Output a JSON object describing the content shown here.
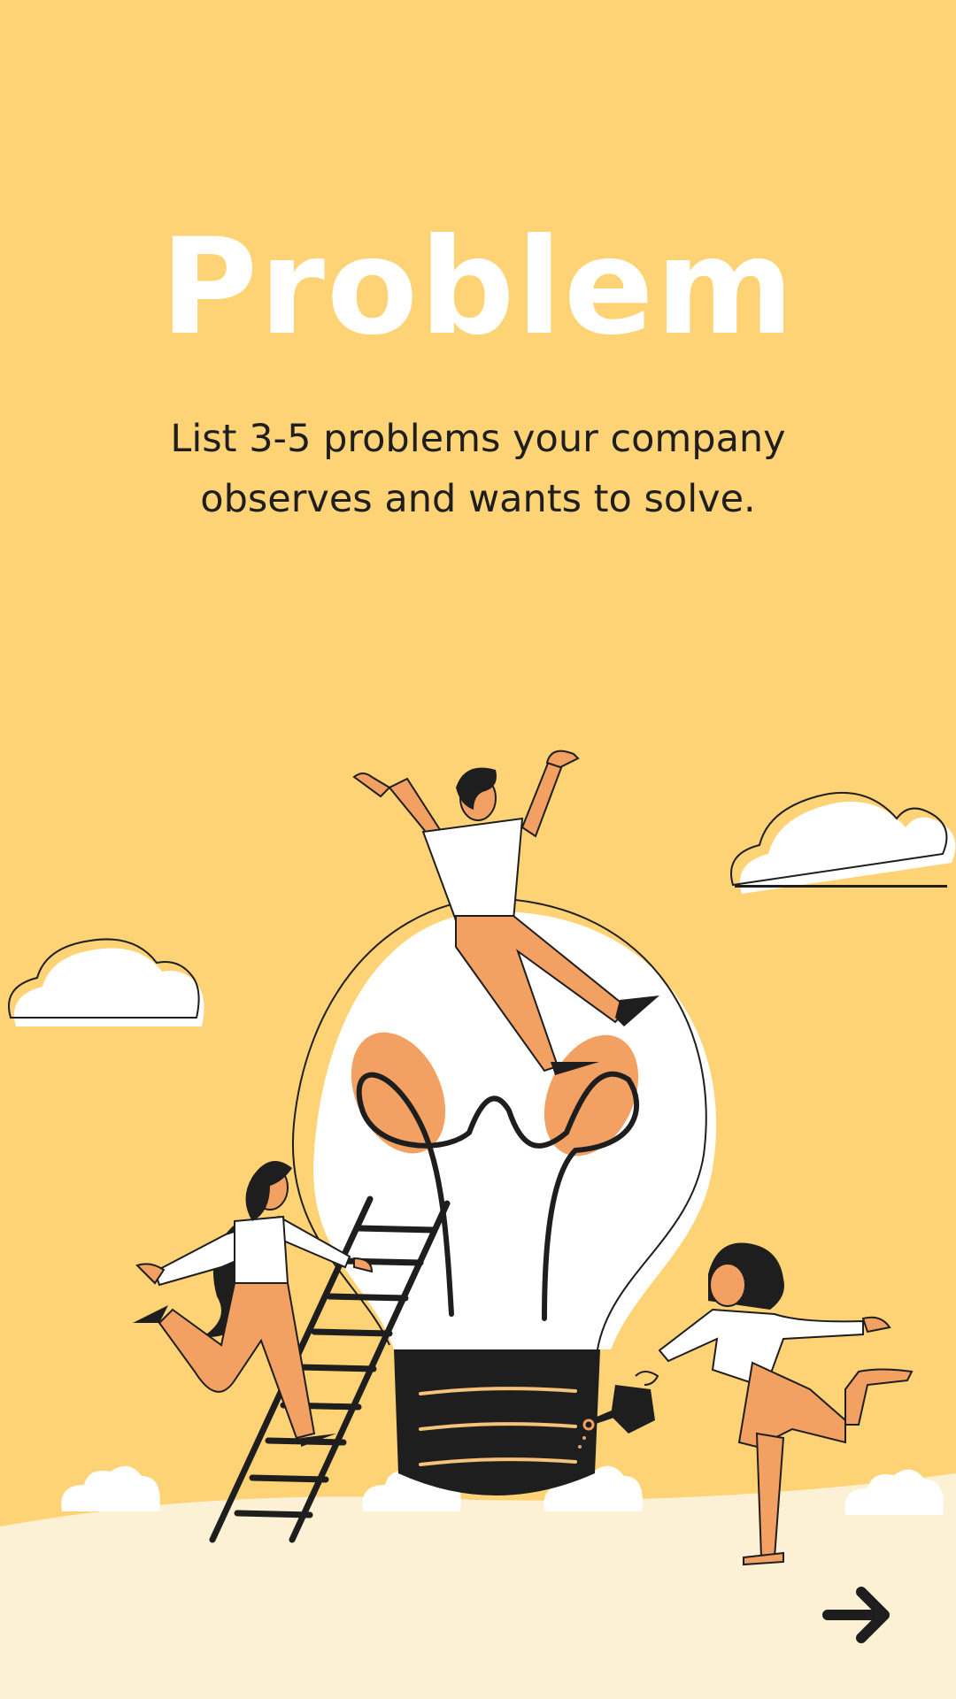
{
  "slide": {
    "title": "Problem",
    "subtitle": "List 3-5 problems your company observes and wants to solve."
  },
  "navigation": {
    "next_icon": "arrow-right-icon"
  },
  "colors": {
    "background": "#FDD375",
    "title": "#FFFFFF",
    "text": "#1E1E1E",
    "ground": "#FCF0D5",
    "skin_accent": "#F3A063",
    "dark": "#1E1E1E"
  },
  "illustration": {
    "icon": "lightbulb-people-illustration"
  }
}
